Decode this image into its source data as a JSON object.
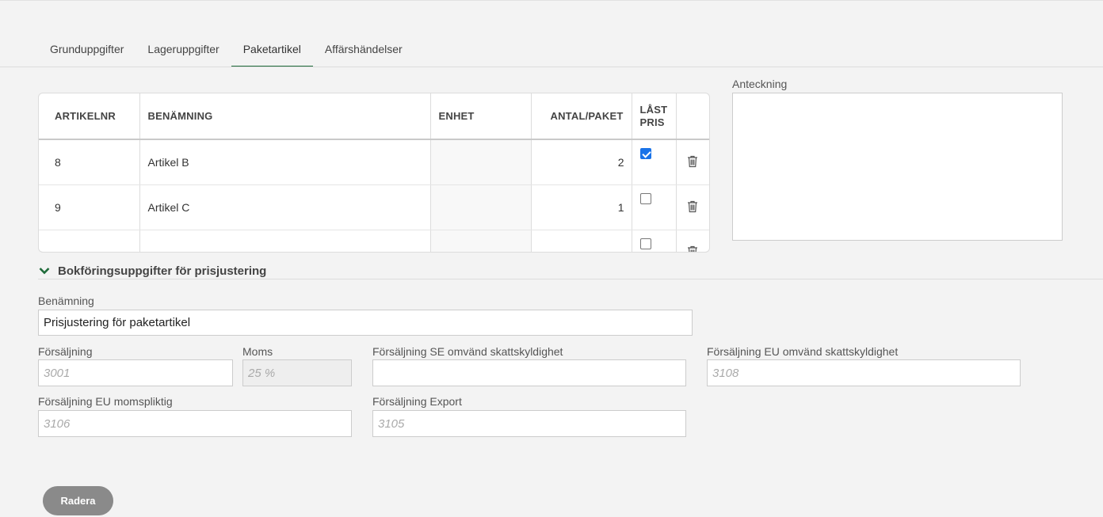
{
  "tabs": [
    {
      "label": "Grunduppgifter"
    },
    {
      "label": "Lageruppgifter"
    },
    {
      "label": "Paketartikel",
      "active": true
    },
    {
      "label": "Affärshändelser"
    }
  ],
  "table": {
    "headers": {
      "artikelnr": "ARTIKELNR",
      "benamning": "BENÄMNING",
      "enhet": "ENHET",
      "antal": "ANTAL/PAKET",
      "last_pris_1": "LÅST",
      "last_pris_2": "PRIS"
    },
    "rows": [
      {
        "artikelnr": "8",
        "benamning": "Artikel B",
        "enhet": "",
        "antal": "2",
        "last_pris": true
      },
      {
        "artikelnr": "9",
        "benamning": "Artikel C",
        "enhet": "",
        "antal": "1",
        "last_pris": false
      },
      {
        "artikelnr": "",
        "benamning": "",
        "enhet": "",
        "antal": "",
        "last_pris": false
      }
    ]
  },
  "note": {
    "label": "Anteckning",
    "value": ""
  },
  "section": {
    "title": "Bokföringsuppgifter för prisjustering",
    "expanded": true,
    "icon": "chevron-down-icon"
  },
  "form": {
    "benamning": {
      "label": "Benämning",
      "value": "Prisjustering för paketartikel"
    },
    "forsaljning": {
      "label": "Försäljning",
      "placeholder": "3001"
    },
    "moms": {
      "label": "Moms",
      "placeholder": "25 %"
    },
    "forsaljning_se_omvand": {
      "label": "Försäljning SE omvänd skattskyldighet",
      "value": ""
    },
    "forsaljning_eu_omvand": {
      "label": "Försäljning EU omvänd skattskyldighet",
      "placeholder": "3108"
    },
    "forsaljning_eu_momspliktig": {
      "label": "Försäljning EU momspliktig",
      "placeholder": "3106"
    },
    "forsaljning_export": {
      "label": "Försäljning Export",
      "placeholder": "3105"
    }
  },
  "actions": {
    "delete_label": "Radera"
  },
  "colors": {
    "accent": "#1f6b3a",
    "checkbox": "#1a73e8",
    "button": "#8a8a8a"
  }
}
